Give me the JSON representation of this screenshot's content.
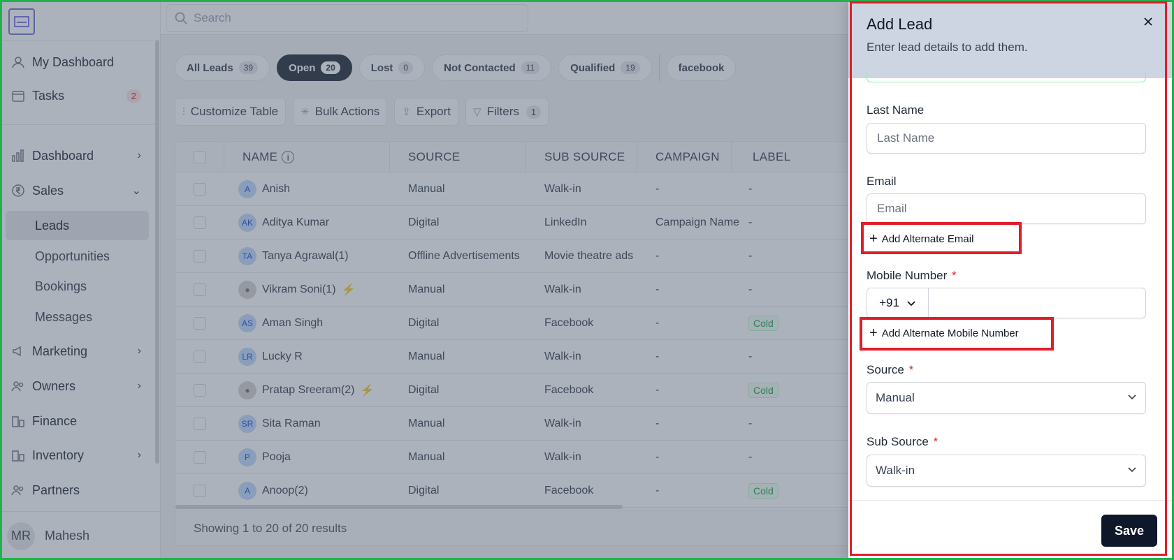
{
  "topbar": {
    "search_placeholder": "Search"
  },
  "sidebar": {
    "items": [
      {
        "label": "My Dashboard",
        "icon": "user-icon"
      },
      {
        "label": "Tasks",
        "icon": "calendar-icon",
        "badge": "2"
      },
      {
        "label": "Dashboard",
        "icon": "bar-chart-icon"
      },
      {
        "label": "Sales",
        "icon": "rupee-icon"
      },
      {
        "label": "Marketing",
        "icon": "megaphone-icon"
      },
      {
        "label": "Owners",
        "icon": "users-icon"
      },
      {
        "label": "Finance",
        "icon": "building-chart-icon"
      },
      {
        "label": "Inventory",
        "icon": "building-chart-icon"
      },
      {
        "label": "Partners",
        "icon": "users-icon"
      }
    ],
    "sales_sub": [
      "Leads",
      "Opportunities",
      "Bookings",
      "Messages"
    ],
    "user": {
      "initials": "MR",
      "name": "Mahesh"
    }
  },
  "tabs": [
    {
      "label": "All Leads",
      "count": "39"
    },
    {
      "label": "Open",
      "count": "20"
    },
    {
      "label": "Lost",
      "count": "0"
    },
    {
      "label": "Not Contacted",
      "count": "11"
    },
    {
      "label": "Qualified",
      "count": "19"
    },
    {
      "label": "facebook"
    }
  ],
  "toolbar": {
    "customize": "Customize Table",
    "bulk": "Bulk Actions",
    "export": "Export",
    "filters": "Filters",
    "filters_count": "1"
  },
  "table": {
    "columns": [
      "NAME",
      "SOURCE",
      "SUB SOURCE",
      "CAMPAIGN",
      "LABEL"
    ],
    "rows": [
      {
        "initials": "A",
        "name": "Anish",
        "source": "Manual",
        "sub": "Walk-in",
        "campaign": "-",
        "label": "-"
      },
      {
        "initials": "AK",
        "name": "Aditya Kumar",
        "source": "Digital",
        "sub": "LinkedIn",
        "campaign": "Campaign Name",
        "label": "-"
      },
      {
        "initials": "TA",
        "name": "Tanya Agrawal(1)",
        "source": "Offline Advertisements",
        "sub": "Movie theatre ads",
        "campaign": "-",
        "label": "-"
      },
      {
        "initials": "",
        "name": "Vikram Soni(1)",
        "source": "Manual",
        "sub": "Walk-in",
        "campaign": "-",
        "label": "-"
      },
      {
        "initials": "AS",
        "name": "Aman Singh",
        "source": "Digital",
        "sub": "Facebook",
        "campaign": "-",
        "label": "Cold"
      },
      {
        "initials": "LR",
        "name": "Lucky R",
        "source": "Manual",
        "sub": "Walk-in",
        "campaign": "-",
        "label": "-"
      },
      {
        "initials": "",
        "name": "Pratap Sreeram(2)",
        "source": "Digital",
        "sub": "Facebook",
        "campaign": "-",
        "label": "Cold"
      },
      {
        "initials": "SR",
        "name": "Sita Raman",
        "source": "Manual",
        "sub": "Walk-in",
        "campaign": "-",
        "label": "-"
      },
      {
        "initials": "P",
        "name": "Pooja",
        "source": "Manual",
        "sub": "Walk-in",
        "campaign": "-",
        "label": "-"
      },
      {
        "initials": "A",
        "name": "Anoop(2)",
        "source": "Digital",
        "sub": "Facebook",
        "campaign": "-",
        "label": "Cold"
      }
    ],
    "footer": "Showing 1 to 20 of 20 results"
  },
  "drawer": {
    "title": "Add Lead",
    "subtitle": "Enter lead details to add them.",
    "last_name_label": "Last Name",
    "last_name_placeholder": "Last Name",
    "email_label": "Email",
    "email_placeholder": "Email",
    "add_alt_email": "Add Alternate Email",
    "mobile_label": "Mobile Number",
    "country_code": "+91",
    "add_alt_mobile": "Add Alternate Mobile Number",
    "source_label": "Source",
    "source_value": "Manual",
    "sub_source_label": "Sub Source",
    "sub_source_value": "Walk-in",
    "required_mark": "*",
    "save": "Save"
  },
  "colors": {
    "highlight": "#e11d2a",
    "frame": "#22b14c",
    "primary": "#0f172a",
    "drawer_header": "#ccd5e1"
  }
}
